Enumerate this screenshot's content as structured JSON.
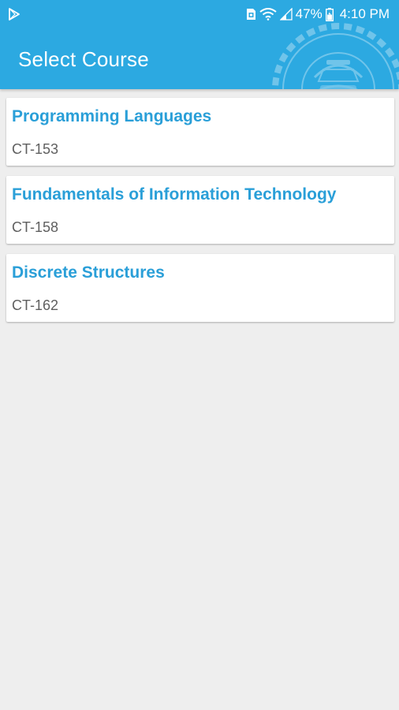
{
  "status_bar": {
    "left_icon": "play-store-notification-icon",
    "icons": [
      "sim-card-icon",
      "wifi-icon",
      "signal-icon",
      "battery-icon"
    ],
    "battery": "47%",
    "time": "4:10 PM"
  },
  "header": {
    "title": "Select Course",
    "logo": "university-seal-logo",
    "background": "#2ca9e1"
  },
  "courses": [
    {
      "name": "Programming Languages",
      "code": "CT-153"
    },
    {
      "name": "Fundamentals of Information Technology",
      "code": "CT-158"
    },
    {
      "name": "Discrete Structures",
      "code": "CT-162"
    }
  ],
  "colors": {
    "accent": "#2a9fd8",
    "code_text": "#5f5f5f",
    "background": "#eeeeee"
  }
}
